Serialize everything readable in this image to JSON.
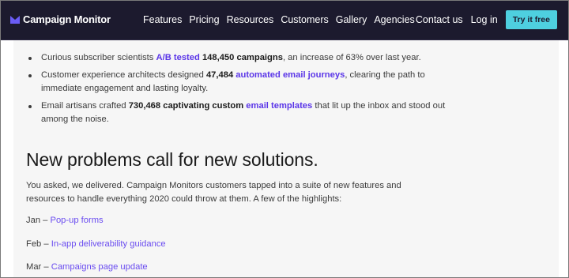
{
  "header": {
    "brand": "Campaign Monitor",
    "nav_items": [
      "Features",
      "Pricing",
      "Resources",
      "Customers",
      "Gallery",
      "Agencies"
    ],
    "contact_label": "Contact us",
    "login_label": "Log in",
    "cta_label": "Try it free",
    "colors": {
      "bar": "#1c1a2e",
      "cta": "#4ecfdf",
      "logo": "#6a5cf5"
    }
  },
  "stats": [
    {
      "pre": "Curious subscriber scientists ",
      "link": "A/B tested",
      "mid": " ",
      "strong": "148,450 campaigns",
      "post": ", an increase of 63% over last year."
    },
    {
      "pre": "Customer experience architects designed ",
      "strong": "47,484",
      "mid": " ",
      "link": "automated email journeys",
      "post": ", clearing the path to immediate engagement and lasting loyalty."
    },
    {
      "pre": "Email artisans crafted ",
      "strong": "730,468 captivating custom",
      "mid": " ",
      "link": "email templates",
      "post": " that lit up the inbox and stood out among the noise."
    }
  ],
  "section": {
    "title": "New problems call for new solutions.",
    "intro": "You asked, we delivered. Campaign Monitors customers tapped into a suite of new features and resources to handle everything 2020 could throw at them. A few of the highlights:"
  },
  "highlights": [
    {
      "month": "Jan",
      "sep": " – ",
      "label": "Pop-up forms"
    },
    {
      "month": "Feb",
      "sep": " – ",
      "label": "In-app deliverability guidance"
    },
    {
      "month": "Mar",
      "sep": " – ",
      "label": "Campaigns page update"
    }
  ],
  "colors": {
    "link": "#5a35e8",
    "content_bg": "#f6f6f6"
  }
}
